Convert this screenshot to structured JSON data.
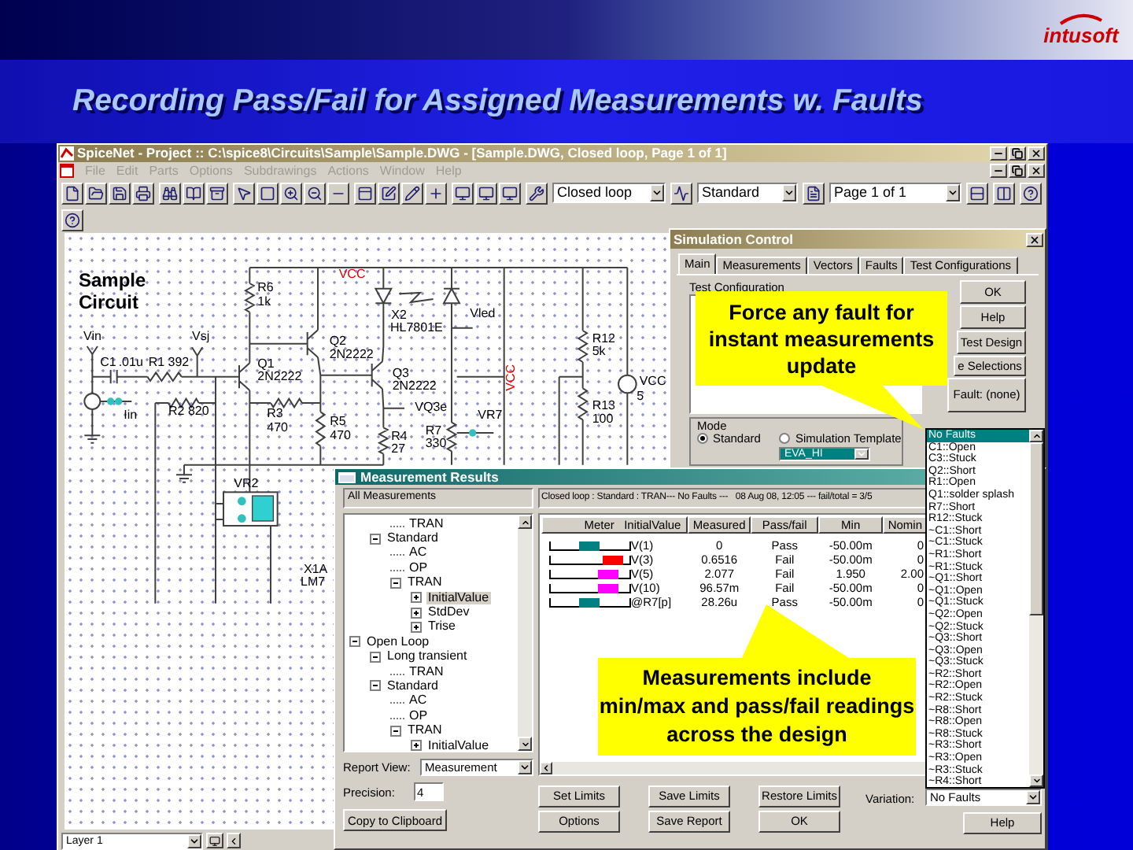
{
  "header": {
    "logo": "intusoft"
  },
  "slide_title": "Recording Pass/Fail for Assigned Measurements w. Faults",
  "app": {
    "title": "SpiceNet - Project :: C:\\spice8\\Circuits\\Sample\\Sample.DWG - [Sample.DWG, Closed loop, Page 1 of 1]",
    "menu": [
      "File",
      "Edit",
      "Parts",
      "Options",
      "Subdrawings",
      "Actions",
      "Window",
      "Help"
    ],
    "toolbar": {
      "configuration": "Closed loop",
      "template": "Standard",
      "page": "Page 1 of 1"
    },
    "layer": "Layer 1"
  },
  "schematic": {
    "title": "Sample Circuit",
    "labels": [
      {
        "text": "VCC",
        "kind": "net"
      },
      {
        "text": "R6",
        "kind": "part"
      },
      {
        "text": "1k",
        "kind": "part"
      },
      {
        "text": "X2",
        "kind": "part"
      },
      {
        "text": "Vled",
        "kind": "part"
      },
      {
        "text": "HL7801E",
        "kind": "part"
      },
      {
        "text": "Vin",
        "kind": "part"
      },
      {
        "text": "Vsj",
        "kind": "part"
      },
      {
        "text": "Q2",
        "kind": "part"
      },
      {
        "text": "R12",
        "kind": "part"
      },
      {
        "text": "2N2222",
        "kind": "part"
      },
      {
        "text": "5k",
        "kind": "part"
      },
      {
        "text": "C1",
        "kind": "part"
      },
      {
        "text": ".01u",
        "kind": "part"
      },
      {
        "text": "R1 392",
        "kind": "part"
      },
      {
        "text": "Q1",
        "kind": "part"
      },
      {
        "text": "2N2222",
        "kind": "part"
      },
      {
        "text": "Q3",
        "kind": "part"
      },
      {
        "text": "2N2222",
        "kind": "part"
      },
      {
        "text": "VCC",
        "kind": "net_vertical"
      },
      {
        "text": "VCC",
        "kind": "part"
      },
      {
        "text": "5",
        "kind": "part"
      },
      {
        "text": "Iin",
        "kind": "part"
      },
      {
        "text": "R2 820",
        "kind": "part"
      },
      {
        "text": "R3",
        "kind": "part"
      },
      {
        "text": "VQ3e",
        "kind": "part"
      },
      {
        "text": "VR7",
        "kind": "part"
      },
      {
        "text": "R13",
        "kind": "part"
      },
      {
        "text": "R5",
        "kind": "part"
      },
      {
        "text": "100",
        "kind": "part"
      },
      {
        "text": "470",
        "kind": "part"
      },
      {
        "text": "R7",
        "kind": "part"
      },
      {
        "text": "470",
        "kind": "part"
      },
      {
        "text": "R4",
        "kind": "part"
      },
      {
        "text": "330",
        "kind": "part"
      },
      {
        "text": "27",
        "kind": "part"
      },
      {
        "text": "VR2",
        "kind": "part"
      },
      {
        "text": "X1A",
        "kind": "part"
      },
      {
        "text": "LM7",
        "kind": "part"
      }
    ]
  },
  "simulation_control": {
    "title": "Simulation Control",
    "tabs": [
      {
        "label": "Main",
        "selected": true
      },
      {
        "label": "Measurements",
        "selected": false
      },
      {
        "label": "Vectors",
        "selected": false
      },
      {
        "label": "Faults",
        "selected": false
      },
      {
        "label": "Test Configurations",
        "selected": false
      }
    ],
    "test_configuration_label": "Test Configuration",
    "buttons": [
      "OK",
      "Help",
      "Test Design",
      "e Selections",
      "Fault: (none)"
    ],
    "mode": {
      "label": "Mode",
      "options": [
        {
          "label": "Standard",
          "selected": true
        },
        {
          "label": "Simulation Template",
          "selected": false
        }
      ],
      "template": "EVA_HI"
    }
  },
  "measurement_results": {
    "title": "Measurement Results",
    "tree_header": "All Measurements",
    "tree": [
      {
        "children": [
          {
            "children": [
              {
                "label": "TRAN",
                "selected": false
              }
            ]
          },
          {
            "label": "Standard",
            "expanded": true,
            "selected": false,
            "children": [
              {
                "label": "AC",
                "selected": false
              },
              {
                "label": "OP",
                "selected": false
              },
              {
                "label": "TRAN",
                "expanded": true,
                "selected": false,
                "children": [
                  {
                    "label": "InitialValue",
                    "expanded": false,
                    "selected": true
                  },
                  {
                    "label": "StdDev",
                    "expanded": false,
                    "selected": false
                  },
                  {
                    "label": "Trise",
                    "expanded": false,
                    "selected": false
                  }
                ]
              }
            ]
          }
        ]
      },
      {
        "label": "Open Loop",
        "expanded": true,
        "selected": false,
        "children": [
          {
            "label": "Long transient",
            "expanded": true,
            "selected": false,
            "children": [
              {
                "label": "TRAN",
                "selected": false
              }
            ]
          },
          {
            "label": "Standard",
            "expanded": true,
            "selected": false,
            "children": [
              {
                "label": "AC",
                "selected": false
              },
              {
                "label": "OP",
                "selected": false
              },
              {
                "label": "TRAN",
                "expanded": true,
                "selected": false,
                "children": [
                  {
                    "label": "InitialValue",
                    "expanded": false,
                    "selected": false
                  }
                ]
              }
            ]
          }
        ]
      }
    ],
    "status": "Closed loop : Standard : TRAN--- No Faults ---   08 Aug 08, 12:05 --- fail/total = 3/5",
    "columns": [
      "Meter",
      "InitialValue",
      "Measured",
      "Pass/fail",
      "Min",
      "Nomin"
    ],
    "rows": [
      {
        "name": "V(1)",
        "measured": "0",
        "result": "Pass",
        "min": "-50.00m",
        "nominal": "0",
        "level": 0.47,
        "color": "#008080"
      },
      {
        "name": "V(3)",
        "measured": "0.6516",
        "result": "Fail",
        "min": "-50.00m",
        "nominal": "0",
        "level": 0.78,
        "color": "#ff0000"
      },
      {
        "name": "V(5)",
        "measured": "2.077",
        "result": "Fail",
        "min": "1.950",
        "nominal": "2.00",
        "level": 0.71,
        "color": "#ff00ff"
      },
      {
        "name": "V(10)",
        "measured": "96.57m",
        "result": "Fail",
        "min": "-50.00m",
        "nominal": "0",
        "level": 0.71,
        "color": "#ff00ff"
      },
      {
        "name": "@R7[p]",
        "measured": "28.26u",
        "result": "Pass",
        "min": "-50.00m",
        "nominal": "0",
        "level": 0.47,
        "color": "#008080"
      }
    ],
    "report_view": {
      "label": "Report View:",
      "value": "Measurement"
    },
    "precision": {
      "label": "Precision:",
      "value": "4"
    },
    "copy_button": "Copy to Clipboard",
    "buttons": [
      "Set Limits",
      "Options",
      "Save Limits",
      "Save Report",
      "Restore Limits",
      "OK"
    ],
    "variation": {
      "label": "Variation:",
      "value": "No Faults"
    },
    "help_button": "Help"
  },
  "fault_list": [
    {
      "label": "No Faults",
      "selected": true
    },
    {
      "label": "C1::Open",
      "selected": false
    },
    {
      "label": "C3::Stuck",
      "selected": false
    },
    {
      "label": "Q2::Short",
      "selected": false
    },
    {
      "label": "R1::Open",
      "selected": false
    },
    {
      "label": "Q1::solder splash",
      "selected": false
    },
    {
      "label": "R7::Short",
      "selected": false
    },
    {
      "label": "R12::Stuck",
      "selected": false
    },
    {
      "label": "~C1::Short",
      "selected": false
    },
    {
      "label": "~C1::Stuck",
      "selected": false
    },
    {
      "label": "~R1::Short",
      "selected": false
    },
    {
      "label": "~R1::Stuck",
      "selected": false
    },
    {
      "label": "~Q1::Short",
      "selected": false
    },
    {
      "label": "~Q1::Open",
      "selected": false
    },
    {
      "label": "~Q1::Stuck",
      "selected": false
    },
    {
      "label": "~Q2::Open",
      "selected": false
    },
    {
      "label": "~Q2::Stuck",
      "selected": false
    },
    {
      "label": "~Q3::Short",
      "selected": false
    },
    {
      "label": "~Q3::Open",
      "selected": false
    },
    {
      "label": "~Q3::Stuck",
      "selected": false
    },
    {
      "label": "~R2::Short",
      "selected": false
    },
    {
      "label": "~R2::Open",
      "selected": false
    },
    {
      "label": "~R2::Stuck",
      "selected": false
    },
    {
      "label": "~R8::Short",
      "selected": false
    },
    {
      "label": "~R8::Open",
      "selected": false
    },
    {
      "label": "~R8::Stuck",
      "selected": false
    },
    {
      "label": "~R3::Short",
      "selected": false
    },
    {
      "label": "~R3::Open",
      "selected": false
    },
    {
      "label": "~R3::Stuck",
      "selected": false
    },
    {
      "label": "~R4::Short",
      "selected": false
    }
  ],
  "callouts": [
    "Force any fault for instant measurements update",
    "Measurements include min/max and pass/fail readings across the design"
  ]
}
